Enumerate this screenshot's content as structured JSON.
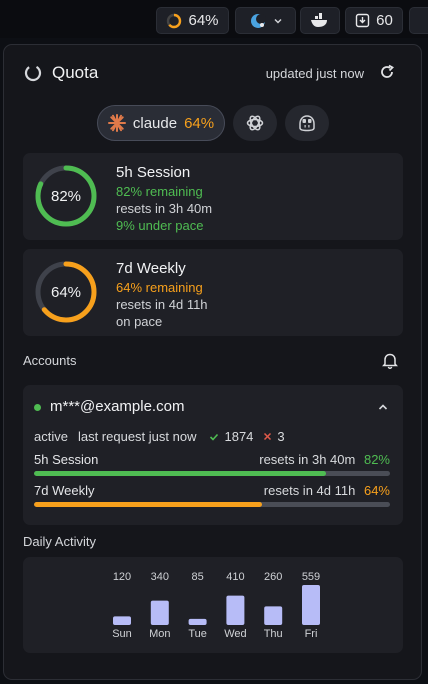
{
  "menubar": {
    "quota_pct": "64%",
    "downloads_count": "60"
  },
  "panel": {
    "title": "Quota",
    "updated": "updated just now"
  },
  "tabs": {
    "active_label": "claude",
    "active_pct": "64%"
  },
  "session": {
    "gauge_pct": "82%",
    "gauge_value": 82,
    "title": "5h Session",
    "remaining": "82% remaining",
    "resets": "resets in 3h 40m",
    "pace": "9% under pace",
    "color": "#4fbc52"
  },
  "weekly": {
    "gauge_pct": "64%",
    "gauge_value": 64,
    "title": "7d Weekly",
    "remaining": "64% remaining",
    "resets": "resets in 4d 11h",
    "pace": "on pace",
    "color": "#f7a01c"
  },
  "accounts": {
    "label": "Accounts",
    "email": "m***@example.com",
    "status": "active",
    "last_request": "last request just now",
    "success_count": "1874",
    "fail_count": "3",
    "bars": [
      {
        "label": "5h Session",
        "resets": "resets in 3h 40m",
        "pct": "82%",
        "value": 82,
        "color": "#4fbc52"
      },
      {
        "label": "7d Weekly",
        "resets": "resets in 4d 11h",
        "pct": "64%",
        "value": 64,
        "color": "#f7a01c"
      }
    ]
  },
  "activity": {
    "label": "Daily Activity"
  },
  "chart_data": {
    "type": "bar",
    "categories": [
      "Sun",
      "Mon",
      "Tue",
      "Wed",
      "Thu",
      "Fri"
    ],
    "values": [
      120,
      340,
      85,
      410,
      260,
      559
    ],
    "bar_color": "#b7bcf7"
  }
}
